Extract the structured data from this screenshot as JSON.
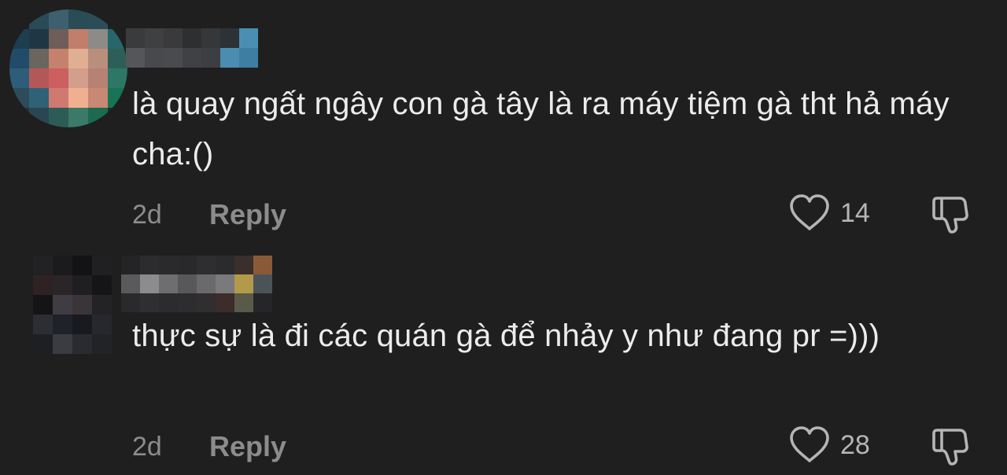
{
  "comments": [
    {
      "text": "là quay ngất ngây con gà tây là ra máy tiệm gà tht hả máy cha:()",
      "time": "2d",
      "reply_label": "Reply",
      "like_count": "14",
      "avatar_pixels": [
        "#1c2024",
        "#2b4a58",
        "#3d5f6e",
        "#2a4c56",
        "#2c4d57",
        "#1d2427",
        "#1d3e4e",
        "#1f3645",
        "#6e5d58",
        "#c07e6b",
        "#8c8b88",
        "#27666a",
        "#214b6a",
        "#6a655f",
        "#c4826c",
        "#e0ae92",
        "#b98f7c",
        "#2d5f58",
        "#2d5d78",
        "#b45759",
        "#cc5f5f",
        "#d49e8c",
        "#b78173",
        "#2d7766",
        "#2d4b5a",
        "#2f6277",
        "#cf7971",
        "#f0b090",
        "#c88874",
        "#197356",
        "#20343c",
        "#2a4652",
        "#2c5c56",
        "#3b7a68",
        "#1c6a4f",
        "#1e2f2c"
      ],
      "username_pixels": [
        "#3a3b3d",
        "#3f4042",
        "#3a3a3c",
        "#2e2f31",
        "#353739",
        "#2c3236",
        "#4a8fb3",
        "#55565a",
        "#48494c",
        "#4a4b4e",
        "#404145",
        "#3c3e41",
        "#4a8db1",
        "#3e7ea3"
      ]
    },
    {
      "text": "thực sự là đi các quán gà để nhảy y như đang pr =)))",
      "time": "2d",
      "reply_label": "Reply",
      "like_count": "28",
      "avatar_pixels": [
        "#222123",
        "#1b1a1c",
        "#131214",
        "#202022",
        "#2e2224",
        "#2a2527",
        "#1f1f21",
        "#151517",
        "#141414",
        "#403c44",
        "#3a3539",
        "#232325",
        "#2d2e33",
        "#1f2228",
        "#181a1f",
        "#26282d",
        "#1e1f23",
        "#3b3c42",
        "#2a2b30",
        "#222327"
      ],
      "username_pixels": [
        "#242426",
        "#2c2c2e",
        "#2a2a2c",
        "#29292b",
        "#2e2e30",
        "#2b2b2d",
        "#3a2f2c",
        "#8a5a38",
        "#5a5a5c",
        "#8c8c8e",
        "#6e6e70",
        "#58585a",
        "#6a6a6c",
        "#7a7a7c",
        "#b39a4a",
        "#4a5458",
        "#2a2a2c",
        "#2f2f31",
        "#2c2c2e",
        "#2d2d2f",
        "#302e2e",
        "#3c2c2a",
        "#5a5a4a",
        "#262628"
      ]
    }
  ]
}
